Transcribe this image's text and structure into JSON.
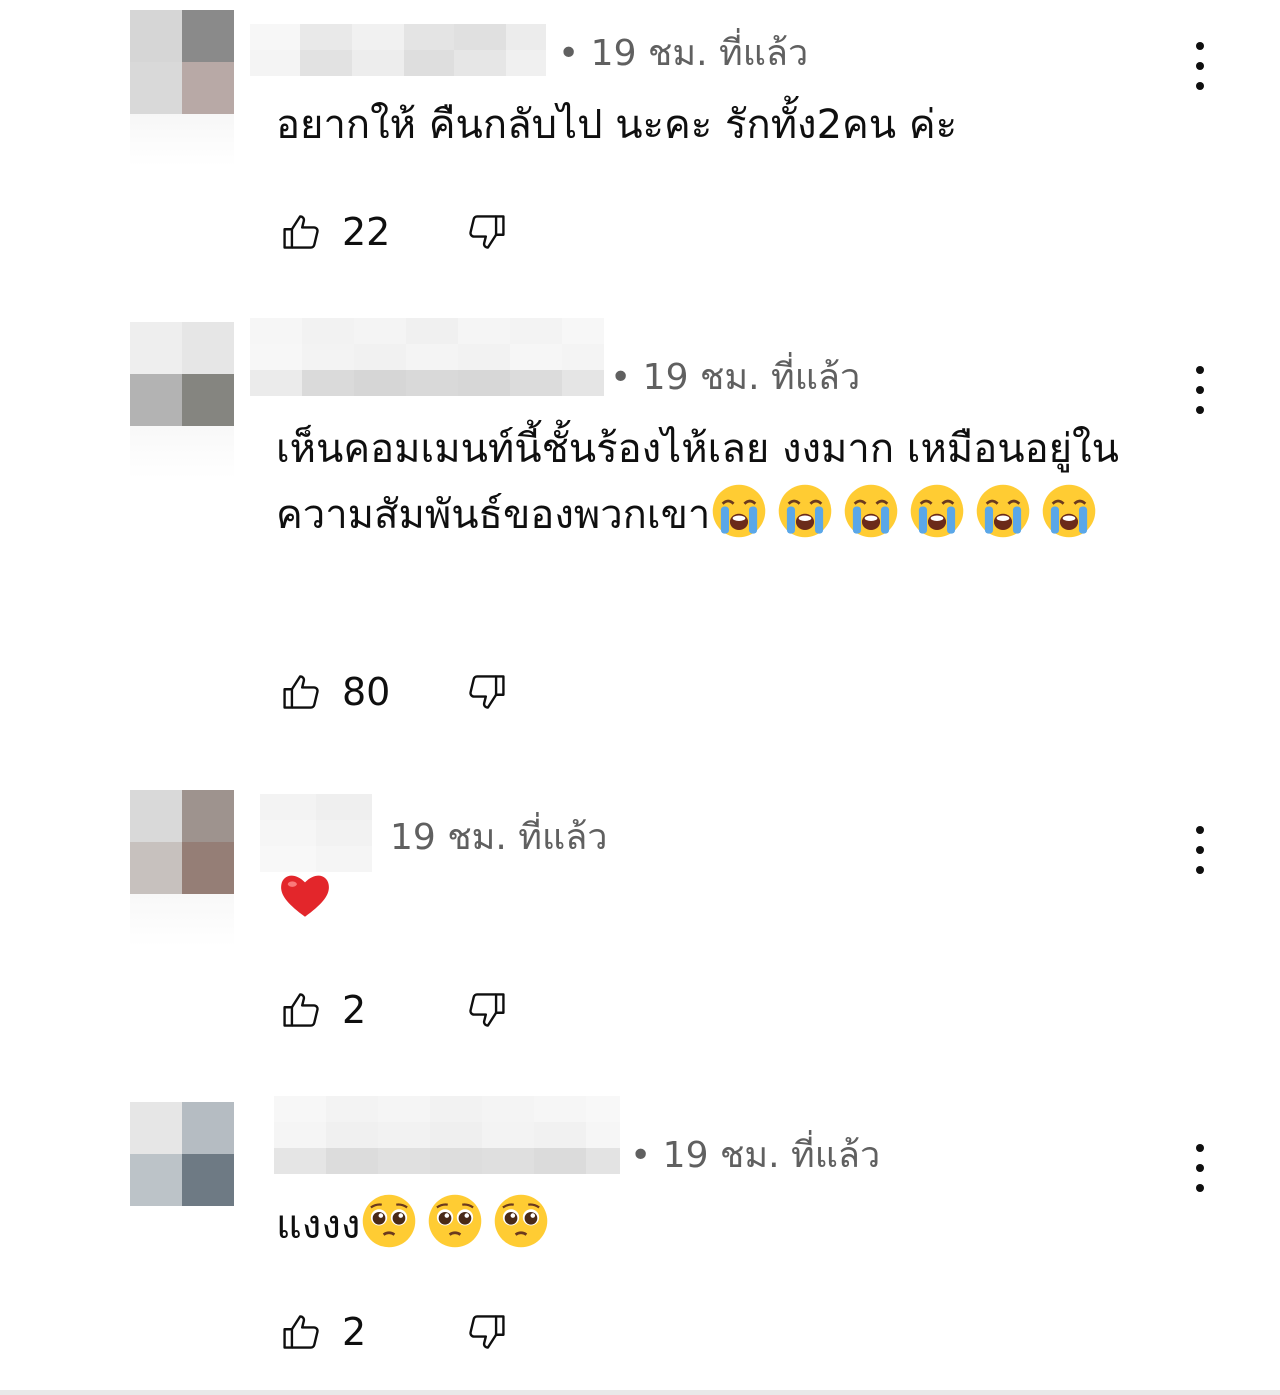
{
  "comments": [
    {
      "meta": "• 19 ชม. ที่แล้ว",
      "text": "อยากให้ คืนกลับไป นะคะ รักทั้ง2คน ค่ะ",
      "likes": "22",
      "avatar_colors": [
        "#d6d6d6",
        "#8a8a8a",
        "#d9d9d9",
        "#b8a9a6"
      ],
      "emojis": []
    },
    {
      "meta": "• 19 ชม. ที่แล้ว",
      "text": "เห็นคอมเมนท์นี้ชั้นร้องไห้เลย งงมาก เหมือนอยู่ในความสัมพันธ์ของพวกเขา",
      "likes": "80",
      "avatar_colors": [
        "#eeeeee",
        "#e6e6e6",
        "#b3b3b3",
        "#858580"
      ],
      "emojis": [
        "loudly-crying-face",
        "loudly-crying-face",
        "loudly-crying-face",
        "loudly-crying-face",
        "loudly-crying-face",
        "loudly-crying-face"
      ]
    },
    {
      "meta": "19 ชม. ที่แล้ว",
      "text": "",
      "likes": "2",
      "avatar_colors": [
        "#d9d9d9",
        "#9e938e",
        "#c7c1be",
        "#957e76"
      ],
      "emojis": [
        "red-heart"
      ]
    },
    {
      "meta": "• 19 ชม. ที่แล้ว",
      "text": "แงงง",
      "likes": "2",
      "avatar_colors": [
        "#e6e6e6",
        "#b5bcc2",
        "#bcc3c8",
        "#6e7a84"
      ],
      "emojis": [
        "pleading-face",
        "pleading-face",
        "pleading-face"
      ]
    }
  ],
  "icons": {
    "like": "thumbs-up-outline-icon",
    "dislike": "thumbs-down-outline-icon",
    "more": "vertical-ellipsis-icon"
  }
}
